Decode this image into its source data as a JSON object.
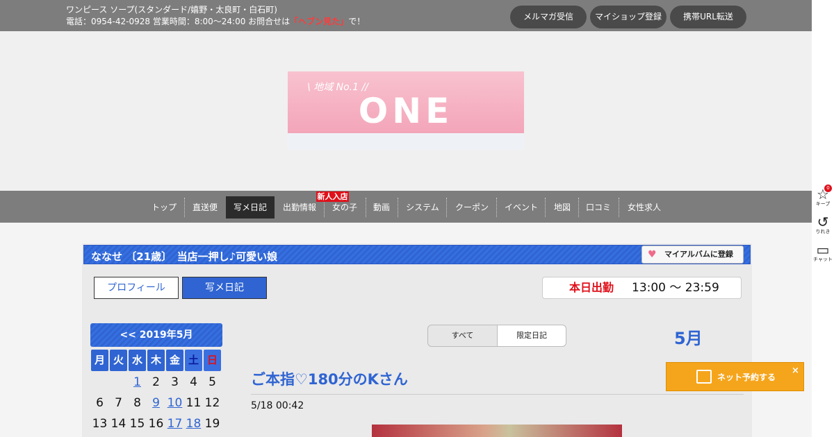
{
  "topbar": {
    "line1": "ワンピース ソープ(スタンダード/嬉野・太良町・白石町)",
    "line2_prefix": "電話：0954-42-0928 営業時間：8:00～24:00 お問合せは",
    "line2_highlight": "「ヘブン見た」",
    "line2_suffix": "で！",
    "buttons": [
      "メルマガ受信",
      "マイショップ登録",
      "携帯URL転送"
    ]
  },
  "logo": {
    "small": "\\ 地域 No.1 //",
    "big": "ONE PEACE"
  },
  "nav": {
    "items": [
      "トップ",
      "直送便",
      "写メ日記",
      "出勤情報",
      "女の子",
      "動画",
      "システム",
      "クーポン",
      "イベント",
      "地図",
      "口コミ",
      "女性求人"
    ],
    "active_index": 2,
    "new_badge": "新人入店"
  },
  "side": {
    "keep_label": "キープ",
    "keep_count": "0",
    "history_label": "りれき",
    "chat_label": "チャット"
  },
  "profile": {
    "title": "ななせ 〔21歳〕　当店一押し♪可愛い娘",
    "album_button": "マイアルバムに登録",
    "tab_profile": "プロフィール",
    "tab_diary": "写メ日記",
    "shift_label": "本日出勤",
    "shift_time": "13:00 ～ 23:59"
  },
  "calendar": {
    "header": "<< 2019年5月",
    "weekdays": [
      "月",
      "火",
      "水",
      "木",
      "金",
      "土",
      "日"
    ],
    "rows": [
      [
        "",
        "",
        "1",
        "2",
        "3",
        "4",
        "5"
      ],
      [
        "6",
        "7",
        "8",
        "9",
        "10",
        "11",
        "12"
      ],
      [
        "13",
        "14",
        "15",
        "16",
        "17",
        "18",
        "19"
      ]
    ],
    "linked_days": [
      "1",
      "9",
      "10",
      "17",
      "18"
    ]
  },
  "diary": {
    "filter_all": "すべて",
    "filter_limited": "限定日記",
    "month": "5月",
    "post_title": "ご本指♡180分のKさん",
    "post_date": "5/18 00:42"
  },
  "reserve": {
    "label": "ネット予約する",
    "close": "×"
  },
  "colors": {
    "accent": "#2f64d2",
    "topbar": "#7d7d7d",
    "red": "#e0101a",
    "reserve": "#f5a51c"
  }
}
